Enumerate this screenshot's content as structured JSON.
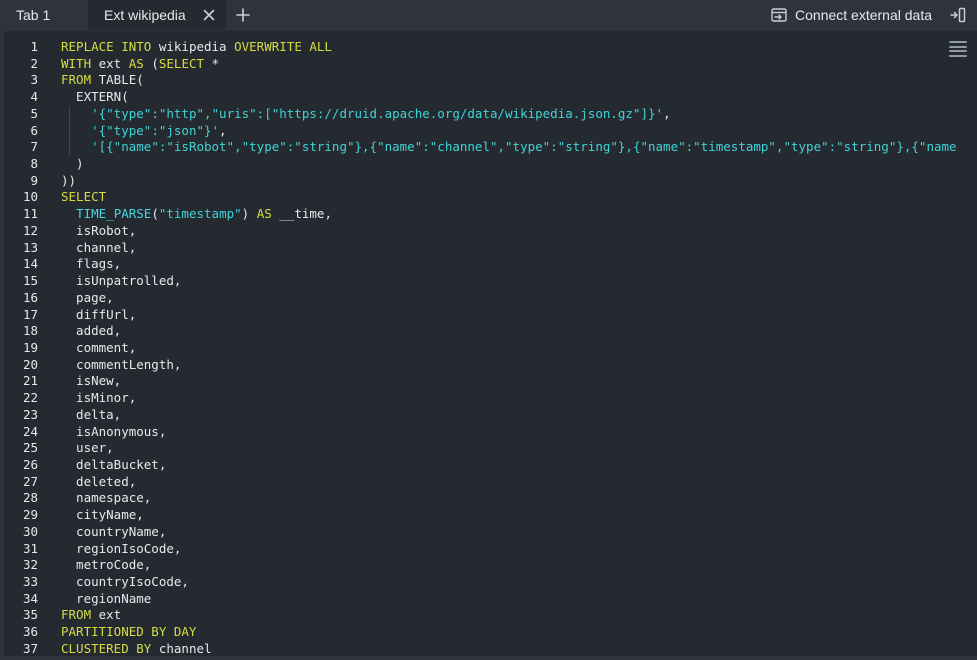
{
  "tabs": [
    {
      "label": "Tab 1"
    },
    {
      "label": "Ext wikipedia"
    }
  ],
  "header": {
    "connect_label": "Connect external data"
  },
  "icons": {
    "close": "close-icon",
    "add": "plus-icon",
    "connect": "connect-data-icon",
    "collapse": "collapse-panel-icon",
    "menu": "hamburger-menu-icon"
  },
  "colors": {
    "background": "#2f343c",
    "editor_background": "#252a31",
    "keyword": "#d5dc42",
    "string": "#3fd3d6",
    "function": "#44d7e4",
    "text": "#e6e9ee"
  },
  "code_lines": [
    {
      "n": "1",
      "parts": [
        {
          "c": "kw",
          "t": "REPLACE INTO"
        },
        {
          "c": "pl",
          "t": " wikipedia "
        },
        {
          "c": "kw",
          "t": "OVERWRITE ALL"
        }
      ]
    },
    {
      "n": "2",
      "parts": [
        {
          "c": "kw",
          "t": "WITH"
        },
        {
          "c": "pl",
          "t": " ext "
        },
        {
          "c": "kw",
          "t": "AS"
        },
        {
          "c": "pl",
          "t": " ("
        },
        {
          "c": "kw",
          "t": "SELECT"
        },
        {
          "c": "pl",
          "t": " *"
        }
      ]
    },
    {
      "n": "3",
      "parts": [
        {
          "c": "kw",
          "t": "FROM"
        },
        {
          "c": "pl",
          "t": " TABLE("
        }
      ]
    },
    {
      "n": "4",
      "parts": [
        {
          "c": "pl",
          "t": "  EXTERN("
        }
      ]
    },
    {
      "n": "5",
      "parts": [
        {
          "c": "pl",
          "t": "    "
        },
        {
          "c": "str",
          "t": "'{\"type\":\"http\",\"uris\":[\"https://druid.apache.org/data/wikipedia.json.gz\"]}'"
        },
        {
          "c": "pl",
          "t": ","
        }
      ]
    },
    {
      "n": "6",
      "parts": [
        {
          "c": "pl",
          "t": "    "
        },
        {
          "c": "str",
          "t": "'{\"type\":\"json\"}'"
        },
        {
          "c": "pl",
          "t": ","
        }
      ]
    },
    {
      "n": "7",
      "parts": [
        {
          "c": "pl",
          "t": "    "
        },
        {
          "c": "str",
          "t": "'[{\"name\":\"isRobot\",\"type\":\"string\"},{\"name\":\"channel\",\"type\":\"string\"},{\"name\":\"timestamp\",\"type\":\"string\"},{\"name"
        }
      ]
    },
    {
      "n": "8",
      "parts": [
        {
          "c": "pl",
          "t": "  )"
        }
      ]
    },
    {
      "n": "9",
      "parts": [
        {
          "c": "pl",
          "t": "))"
        }
      ]
    },
    {
      "n": "10",
      "parts": [
        {
          "c": "kw",
          "t": "SELECT"
        }
      ]
    },
    {
      "n": "11",
      "parts": [
        {
          "c": "pl",
          "t": "  "
        },
        {
          "c": "fn",
          "t": "TIME_PARSE"
        },
        {
          "c": "pl",
          "t": "("
        },
        {
          "c": "str",
          "t": "\"timestamp\""
        },
        {
          "c": "pl",
          "t": ") "
        },
        {
          "c": "kw",
          "t": "AS"
        },
        {
          "c": "pl",
          "t": " __time,"
        }
      ]
    },
    {
      "n": "12",
      "parts": [
        {
          "c": "pl",
          "t": "  isRobot,"
        }
      ]
    },
    {
      "n": "13",
      "parts": [
        {
          "c": "pl",
          "t": "  channel,"
        }
      ]
    },
    {
      "n": "14",
      "parts": [
        {
          "c": "pl",
          "t": "  flags,"
        }
      ]
    },
    {
      "n": "15",
      "parts": [
        {
          "c": "pl",
          "t": "  isUnpatrolled,"
        }
      ]
    },
    {
      "n": "16",
      "parts": [
        {
          "c": "pl",
          "t": "  page,"
        }
      ]
    },
    {
      "n": "17",
      "parts": [
        {
          "c": "pl",
          "t": "  diffUrl,"
        }
      ]
    },
    {
      "n": "18",
      "parts": [
        {
          "c": "pl",
          "t": "  added,"
        }
      ]
    },
    {
      "n": "19",
      "parts": [
        {
          "c": "pl",
          "t": "  comment,"
        }
      ]
    },
    {
      "n": "20",
      "parts": [
        {
          "c": "pl",
          "t": "  commentLength,"
        }
      ]
    },
    {
      "n": "21",
      "parts": [
        {
          "c": "pl",
          "t": "  isNew,"
        }
      ]
    },
    {
      "n": "22",
      "parts": [
        {
          "c": "pl",
          "t": "  isMinor,"
        }
      ]
    },
    {
      "n": "23",
      "parts": [
        {
          "c": "pl",
          "t": "  delta,"
        }
      ]
    },
    {
      "n": "24",
      "parts": [
        {
          "c": "pl",
          "t": "  isAnonymous,"
        }
      ]
    },
    {
      "n": "25",
      "parts": [
        {
          "c": "pl",
          "t": "  user,"
        }
      ]
    },
    {
      "n": "26",
      "parts": [
        {
          "c": "pl",
          "t": "  deltaBucket,"
        }
      ]
    },
    {
      "n": "27",
      "parts": [
        {
          "c": "pl",
          "t": "  deleted,"
        }
      ]
    },
    {
      "n": "28",
      "parts": [
        {
          "c": "pl",
          "t": "  namespace,"
        }
      ]
    },
    {
      "n": "29",
      "parts": [
        {
          "c": "pl",
          "t": "  cityName,"
        }
      ]
    },
    {
      "n": "30",
      "parts": [
        {
          "c": "pl",
          "t": "  countryName,"
        }
      ]
    },
    {
      "n": "31",
      "parts": [
        {
          "c": "pl",
          "t": "  regionIsoCode,"
        }
      ]
    },
    {
      "n": "32",
      "parts": [
        {
          "c": "pl",
          "t": "  metroCode,"
        }
      ]
    },
    {
      "n": "33",
      "parts": [
        {
          "c": "pl",
          "t": "  countryIsoCode,"
        }
      ]
    },
    {
      "n": "34",
      "parts": [
        {
          "c": "pl",
          "t": "  regionName"
        }
      ]
    },
    {
      "n": "35",
      "parts": [
        {
          "c": "kw",
          "t": "FROM"
        },
        {
          "c": "pl",
          "t": " ext"
        }
      ]
    },
    {
      "n": "36",
      "parts": [
        {
          "c": "kw",
          "t": "PARTITIONED BY DAY"
        }
      ]
    },
    {
      "n": "37",
      "parts": [
        {
          "c": "kw",
          "t": "CLUSTERED BY"
        },
        {
          "c": "pl",
          "t": " channel"
        }
      ]
    }
  ]
}
